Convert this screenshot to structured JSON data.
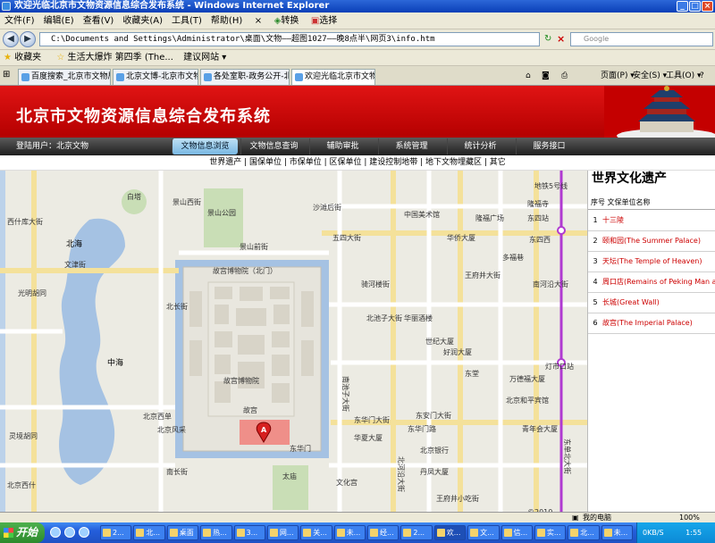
{
  "window": {
    "title": "欢迎光临北京市文物资源信息综合发布系统 - Windows Internet Explorer"
  },
  "menu": [
    "文件(F)",
    "编辑(E)",
    "查看(V)",
    "收藏夹(A)",
    "工具(T)",
    "帮助(H)"
  ],
  "menu_extras": {
    "convert": "转换",
    "select": "选择",
    "close_x": "×"
  },
  "address": {
    "url": "C:\\Documents and Settings\\Administrator\\桌面\\文物——超图1027——晚8点半\\网页3\\info.htm",
    "search_placeholder": "Google"
  },
  "favorites": {
    "label": "收藏夹",
    "items": [
      "生活大爆炸 第四季 (The...",
      "建议网站 ▾"
    ]
  },
  "tabs": [
    "百度搜索_北京市文物局",
    "北京文博-北京市文物局...",
    "各处室职-政务公开-北京...",
    "欢迎光临北京市文物..."
  ],
  "toolbar_right": {
    "page": "页面(P) ▾",
    "safety": "安全(S) ▾",
    "tools": "工具(O) ▾"
  },
  "banner": {
    "title": "北京市文物资源信息综合发布系统"
  },
  "nav": {
    "login_user": "登陆用户：北京文物",
    "tabs": [
      "文物信息浏览",
      "文物信息查询",
      "辅助审批",
      "系统管理",
      "统计分析",
      "服务接口"
    ],
    "active_tab": "文物信息浏览"
  },
  "subnav": "世界遗产 | 国保单位 | 市保单位 | 区保单位 | 建设控制地带 | 地下文物埋藏区 | 其它",
  "map": {
    "labels": [
      "西什库大街",
      "北海",
      "白塔",
      "景山公园",
      "景山西街",
      "景山前街",
      "故宫博物院（北门）",
      "故宫博物院",
      "故宫",
      "中海",
      "北京西单",
      "北京西什",
      "文津街",
      "光明胡同",
      "北长街",
      "南长街",
      "灵境胡同",
      "北京风采",
      "东华门大街",
      "东安门大街",
      "王府井大街",
      "沙滩后街",
      "五四大街",
      "华侨大厦",
      "中国美术馆",
      "隆福广场",
      "东四西",
      "多福巷",
      "世纪大厦",
      "华丽酒楼",
      "好润大厦",
      "东堂",
      "万德福大厦",
      "灯市口站",
      "北京和平宾馆",
      "青年会大厦",
      "南池子大街",
      "北池子大街",
      "丹凤大厦",
      "王府井小吃街",
      "太庙",
      "东华门",
      "华夏大厦",
      "东华门路",
      "文化宫",
      "骑河楼街",
      "北河沿大街",
      "南河沿大街",
      "地铁5号线",
      "东四站",
      "隆福寺",
      "东单北大街",
      "北京银行"
    ],
    "copyright": "©2010"
  },
  "panel": {
    "title": "世界文化遗产",
    "header": "序号  文保单位名称",
    "rows": [
      {
        "no": "1",
        "name": "十三陵"
      },
      {
        "no": "2",
        "name": "颐和园(The Summer Palace)"
      },
      {
        "no": "3",
        "name": "天坛(The Temple of Heaven)"
      },
      {
        "no": "4",
        "name": "周口店(Remains of Peking Man at Zhoukoudian)"
      },
      {
        "no": "5",
        "name": "长城(Great Wall)"
      },
      {
        "no": "6",
        "name": "故宫(The Imperial Palace)"
      }
    ]
  },
  "statusbar": {
    "zone": "我的电脑",
    "zoom": "100%"
  },
  "taskbar": {
    "start": "开始",
    "buttons": [
      "2...",
      "北...",
      "桌面",
      "热...",
      "3...",
      "网...",
      "关...",
      "未...",
      "经...",
      "2...",
      "欢...",
      "文...",
      "信...",
      "实...",
      "北...",
      "未..."
    ],
    "tray_time": "1:55",
    "net_speed": "0KB/S"
  }
}
